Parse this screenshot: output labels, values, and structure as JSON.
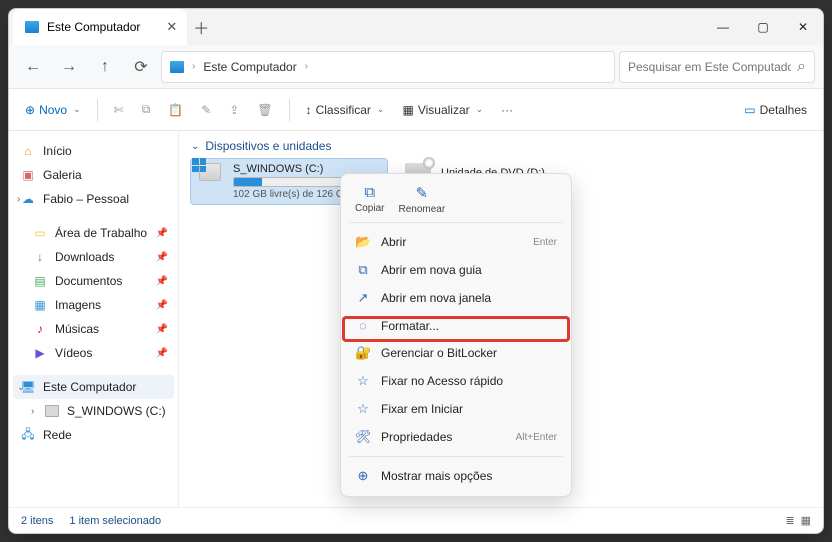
{
  "window": {
    "tab_title": "Este Computador",
    "min": "—",
    "max": "▢",
    "close": "✕"
  },
  "nav": {
    "back": "←",
    "forward": "→",
    "up": "↑",
    "refresh": "⟳"
  },
  "breadcrumb": {
    "root": "Este Computador"
  },
  "search": {
    "placeholder": "Pesquisar em Este Computador"
  },
  "toolbar": {
    "novo": "Novo",
    "classificar": "Classificar",
    "visualizar": "Visualizar",
    "detalhes": "Detalhes"
  },
  "sidebar": {
    "inicio": "Início",
    "galeria": "Galeria",
    "onedrive": "Fabio – Pessoal",
    "desktop": "Área de Trabalho",
    "downloads": "Downloads",
    "documentos": "Documentos",
    "imagens": "Imagens",
    "musicas": "Músicas",
    "videos": "Vídeos",
    "este_pc": "Este Computador",
    "drive_c": "S_WINDOWS (C:)",
    "rede": "Rede"
  },
  "content": {
    "group": "Dispositivos e unidades",
    "drive_c": {
      "name": "S_WINDOWS (C:)",
      "free": "102 GB livre(s) de 126 GB",
      "fill_pct": 19
    },
    "dvd": {
      "name": "Unidade de DVD (D:)",
      "tag": "DVD"
    }
  },
  "context": {
    "copiar": "Copiar",
    "renomear": "Renomear",
    "abrir": "Abrir",
    "abrir_sc": "Enter",
    "nova_guia": "Abrir em nova guia",
    "nova_janela": "Abrir em nova janela",
    "formatar": "Formatar...",
    "bitlocker": "Gerenciar o BitLocker",
    "pin_quick": "Fixar no Acesso rápido",
    "pin_start": "Fixar em Iniciar",
    "propriedades": "Propriedades",
    "prop_sc": "Alt+Enter",
    "mais": "Mostrar mais opções"
  },
  "status": {
    "count": "2 itens",
    "selected": "1 item selecionado"
  }
}
